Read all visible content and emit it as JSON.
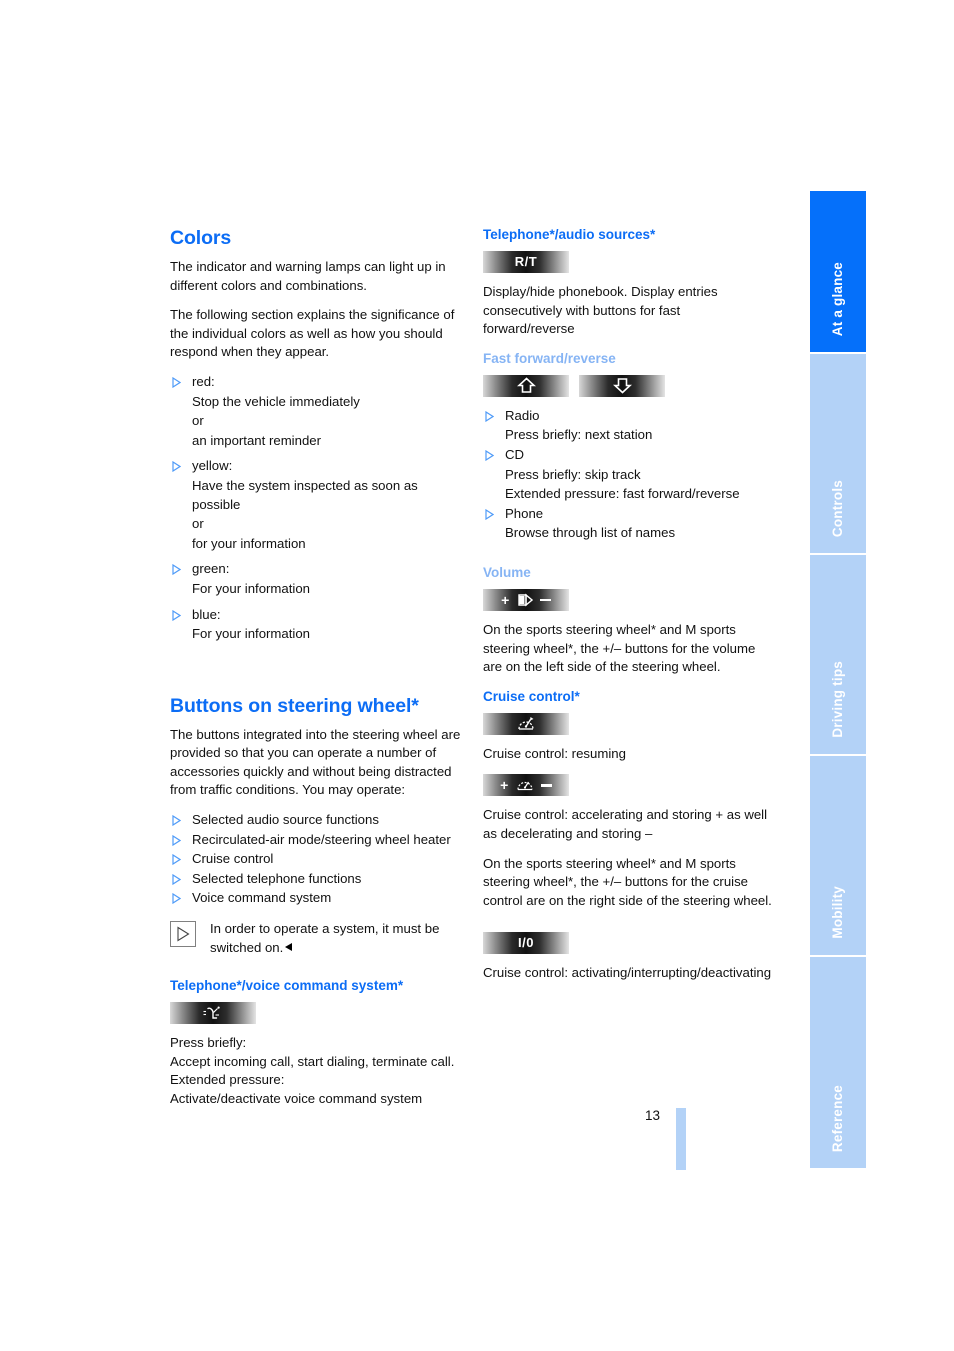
{
  "document": {
    "page_number": "13"
  },
  "sidebar": {
    "tabs": [
      {
        "label": "At a glance",
        "active": true
      },
      {
        "label": "Controls",
        "active": false
      },
      {
        "label": "Driving tips",
        "active": false
      },
      {
        "label": "Mobility",
        "active": false
      },
      {
        "label": "Reference",
        "active": false
      }
    ]
  },
  "colors": {
    "heading_blue": "#0c6df5",
    "subtle_blue": "#86b4f4",
    "tab_active": "#0570fa",
    "tab_inactive": "#b3d2f7",
    "bullet_blue": "#4f9bf8"
  },
  "left_column": {
    "colors_section": {
      "heading": "Colors",
      "paragraph_1": "The indicator and warning lamps can light up in different colors and combinations.",
      "paragraph_2": "The following section explains the significance of the individual colors as well as how you should respond when they appear.",
      "items": [
        {
          "term": "red:",
          "lines": [
            "Stop the vehicle immediately",
            "or",
            "an important reminder"
          ]
        },
        {
          "term": "yellow:",
          "lines": [
            "Have the system inspected as soon as possible",
            "or",
            "for your information"
          ]
        },
        {
          "term": "green:",
          "lines": [
            "For your information"
          ]
        },
        {
          "term": "blue:",
          "lines": [
            "For your information"
          ]
        }
      ]
    },
    "steering_wheel_section": {
      "heading": "Buttons on steering wheel*",
      "paragraph_1": "The buttons integrated into the steering wheel are provided so that you can operate a number of accessories quickly and without being distracted from traffic conditions. You may operate:",
      "items": [
        "Selected audio source functions",
        "Recirculated-air mode/steering wheel heater",
        "Cruise control",
        "Selected telephone functions",
        "Voice command system"
      ],
      "note": "In order to operate a system, it must be switched on."
    },
    "telephone_voice_section": {
      "heading": "Telephone*/voice command system*",
      "button_icon": "phone-voice-icon",
      "lines": [
        "Press briefly:",
        "Accept incoming call, start dialing, terminate call.",
        "Extended pressure:",
        "Activate/deactivate voice command system"
      ]
    }
  },
  "right_column": {
    "telephone_audio_section": {
      "heading": "Telephone*/audio sources*",
      "button_label": "R/T",
      "paragraph": "Display/hide phonebook. Display entries consecutively with buttons for fast forward/reverse"
    },
    "fast_forward_section": {
      "heading": "Fast forward/reverse",
      "buttons": [
        "arrow-up-icon",
        "arrow-down-icon"
      ],
      "items": [
        {
          "term": "Radio",
          "lines": [
            "Press briefly: next station"
          ]
        },
        {
          "term": "CD",
          "lines": [
            "Press briefly: skip track",
            "Extended pressure: fast forward/reverse"
          ]
        },
        {
          "term": "Phone",
          "lines": [
            "Browse through list of names"
          ]
        }
      ]
    },
    "volume_section": {
      "heading": "Volume",
      "button_icon": "volume-plus-minus-icon",
      "paragraph": "On the sports steering wheel* and M sports steering wheel*, the +/– buttons for the volume are on the left side of the steering wheel."
    },
    "cruise_control_section": {
      "heading": "Cruise control*",
      "button_1_icon": "cruise-resume-icon",
      "paragraph_1": "Cruise control: resuming",
      "button_2_icon": "cruise-plus-minus-icon",
      "paragraph_2": "Cruise control: accelerating and storing + as well as decelerating and storing –",
      "paragraph_3": "On the sports steering wheel* and M sports steering wheel*, the +/– buttons for the cruise control are on the right side of the steering wheel.",
      "button_3_label": "I/0",
      "paragraph_4": "Cruise control: activating/interrupting/deactivating"
    }
  }
}
